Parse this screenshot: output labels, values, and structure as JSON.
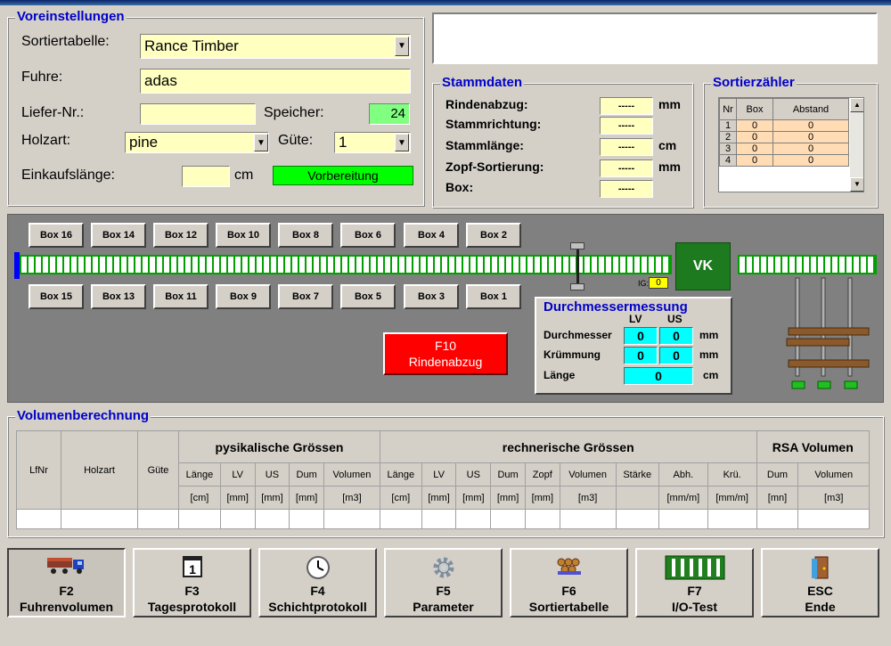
{
  "presets": {
    "title": "Voreinstellungen",
    "sort_table_label": "Sortiertabelle:",
    "sort_table_value": "Rance Timber",
    "load_label": "Fuhre:",
    "load_value": "adas",
    "delivery_no_label": "Liefer-Nr.:",
    "delivery_no_value": "",
    "memory_label": "Speicher:",
    "memory_value": "24",
    "wood_type_label": "Holzart:",
    "wood_type_value": "pine",
    "quality_label": "Güte:",
    "quality_value": "1",
    "purchase_length_label": "Einkaufslänge:",
    "purchase_length_value": "",
    "purchase_length_unit": "cm",
    "status": "Vorbereitung"
  },
  "master_data": {
    "title": "Stammdaten",
    "rows": [
      {
        "label": "Rindenabzug:",
        "value": "-----",
        "unit": "mm"
      },
      {
        "label": "Stammrichtung:",
        "value": "-----",
        "unit": ""
      },
      {
        "label": "Stammlänge:",
        "value": "-----",
        "unit": "cm"
      },
      {
        "label": "Zopf-Sortierung:",
        "value": "-----",
        "unit": "mm"
      },
      {
        "label": "Box:",
        "value": "-----",
        "unit": ""
      }
    ]
  },
  "sort_counter": {
    "title": "Sortierzähler",
    "headers": [
      "Nr",
      "Box",
      "Abstand"
    ],
    "rows": [
      {
        "nr": "1",
        "box": "0",
        "dist": "0"
      },
      {
        "nr": "2",
        "box": "0",
        "dist": "0"
      },
      {
        "nr": "3",
        "box": "0",
        "dist": "0"
      },
      {
        "nr": "4",
        "box": "0",
        "dist": "0"
      }
    ]
  },
  "conveyor": {
    "top_boxes": [
      "Box 16",
      "Box 14",
      "Box 12",
      "Box 10",
      "Box 8",
      "Box 6",
      "Box 4",
      "Box 2"
    ],
    "bottom_boxes": [
      "Box 15",
      "Box 13",
      "Box 11",
      "Box 9",
      "Box 7",
      "Box 5",
      "Box 3",
      "Box 1"
    ],
    "ig_label": "IG:",
    "ig_value": "0",
    "vk_label": "VK",
    "bark_button": {
      "key": "F10",
      "label": "Rindenabzug"
    }
  },
  "diameter": {
    "title": "Durchmessermessung",
    "col_lv": "LV",
    "col_us": "US",
    "rows": [
      {
        "label": "Durchmesser",
        "lv": "0",
        "us": "0",
        "unit": "mm"
      },
      {
        "label": "Krümmung",
        "lv": "0",
        "us": "0",
        "unit": "mm"
      }
    ],
    "length_label": "Länge",
    "length_value": "0",
    "length_unit": "cm"
  },
  "volume": {
    "title": "Volumenberechnung",
    "col_lfnr": "LfNr",
    "col_holzart": "Holzart",
    "col_guete": "Güte",
    "group_physical": "pysikalische Grössen",
    "group_calculated": "rechnerische Grössen",
    "group_rsa": "RSA Volumen",
    "physical_cols": [
      "Länge",
      "LV",
      "US",
      "Dum",
      "Volumen"
    ],
    "physical_units": [
      "[cm]",
      "[mm]",
      "[mm]",
      "[mm]",
      "[m3]"
    ],
    "calculated_cols": [
      "Länge",
      "LV",
      "US",
      "Dum",
      "Zopf",
      "Volumen",
      "Stärke",
      "Abh.",
      "Krü."
    ],
    "calculated_units": [
      "[cm]",
      "[mm]",
      "[mm]",
      "[mm]",
      "[mm]",
      "[m3]",
      "",
      "[mm/m]",
      "[mm/m]"
    ],
    "rsa_cols": [
      "Dum",
      "Volumen"
    ],
    "rsa_units": [
      "[mn]",
      "[m3]"
    ]
  },
  "function_keys": [
    {
      "key": "F2",
      "label": "Fuhrenvolumen",
      "icon": "truck-icon"
    },
    {
      "key": "F3",
      "label": "Tagesprotokoll",
      "icon": "calendar-icon",
      "icon_text": "1"
    },
    {
      "key": "F4",
      "label": "Schichtprotokoll",
      "icon": "clock-icon"
    },
    {
      "key": "F5",
      "label": "Parameter",
      "icon": "gear-icon"
    },
    {
      "key": "F6",
      "label": "Sortiertabelle",
      "icon": "logs-icon"
    },
    {
      "key": "F7",
      "label": "I/O-Test",
      "icon": "circuit-board-icon"
    },
    {
      "key": "ESC",
      "label": "Ende",
      "icon": "exit-door-icon"
    }
  ]
}
